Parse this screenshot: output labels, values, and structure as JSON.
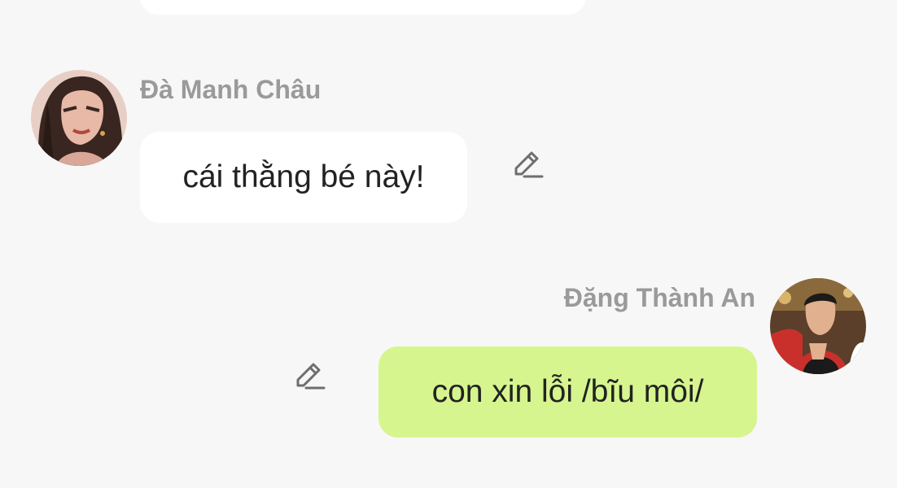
{
  "messages": [
    {
      "sender": "Đà Manh Châu",
      "text": "cái thằng bé này!",
      "side": "left",
      "avatar_icon": "avatar-woman",
      "bubble_color": "#ffffff",
      "edit_icon": "pencil-icon"
    },
    {
      "sender": "Đặng Thành An",
      "text": "con xin lỗi /bĩu môi/",
      "side": "right",
      "avatar_icon": "avatar-man",
      "bubble_color": "#d6f58e",
      "edit_icon": "pencil-icon"
    }
  ],
  "colors": {
    "background": "#f7f7f7",
    "name_text": "#9a9a9a",
    "message_text": "#222222"
  }
}
